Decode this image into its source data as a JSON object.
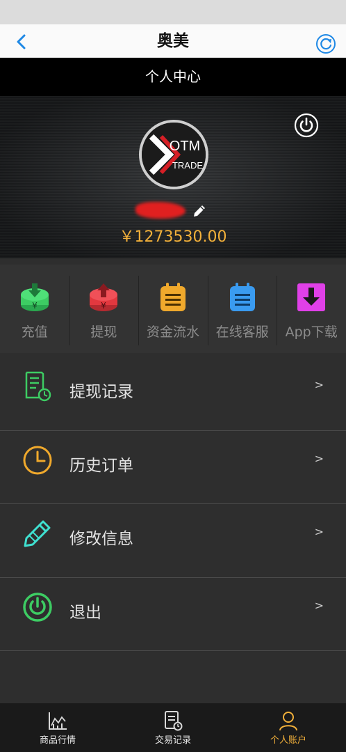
{
  "header": {
    "title": "奥美"
  },
  "page": {
    "title": "个人中心"
  },
  "profile": {
    "avatar_text_top": "OTM",
    "avatar_text_bottom": "TRADE",
    "balance": "￥1273530.00"
  },
  "quick_actions": [
    {
      "label": "充值",
      "icon": "deposit-icon",
      "color": "#3dcc63"
    },
    {
      "label": "提现",
      "icon": "withdraw-icon",
      "color": "#e2383f"
    },
    {
      "label": "资金流水",
      "icon": "ledger-icon",
      "color": "#f0a92c"
    },
    {
      "label": "在线客服",
      "icon": "support-icon",
      "color": "#3a9bf0"
    },
    {
      "label": "App下载",
      "icon": "download-icon",
      "color": "#e040e8"
    }
  ],
  "menu": [
    {
      "label": "提现记录",
      "icon": "withdraw-record-icon",
      "arrow": ">",
      "color": "#3dcc63"
    },
    {
      "label": "历史订单",
      "icon": "clock-icon",
      "arrow": ">",
      "color": "#f0a92c"
    },
    {
      "label": "修改信息",
      "icon": "pencil-icon",
      "arrow": ">",
      "color": "#3fe0d0"
    },
    {
      "label": "退出",
      "icon": "power-icon",
      "arrow": ">",
      "color": "#3dcc63"
    }
  ],
  "tabs": [
    {
      "label": "商品行情",
      "icon": "chart-icon",
      "active": false
    },
    {
      "label": "交易记录",
      "icon": "record-icon",
      "active": false
    },
    {
      "label": "个人账户",
      "icon": "user-icon",
      "active": true
    }
  ],
  "colors": {
    "accent": "#f2b03a",
    "nav_blue": "#1e88e5"
  }
}
